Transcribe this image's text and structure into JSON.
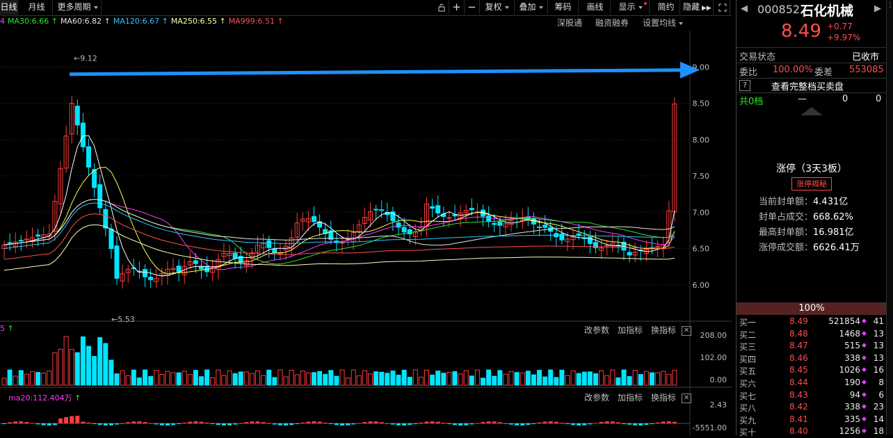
{
  "toolbar": {
    "tab_daily": "日线",
    "tab_monthly": "月线",
    "more_periods": "更多周期",
    "fq": "复权",
    "overlay": "叠加",
    "chips": "筹码",
    "draw": "画线",
    "display": "显示",
    "simple": "简约",
    "hide": "隐藏"
  },
  "ma_legend": [
    {
      "text": "4",
      "color": "#ff3cff"
    },
    {
      "text": "MA30:6.66",
      "color": "#2ee62e"
    },
    {
      "text": "MA60:6.82",
      "color": "#e6e6e6"
    },
    {
      "text": "MA120:6.67",
      "color": "#2fc8ff"
    },
    {
      "text": "MA250:6.55",
      "color": "#ffffb0"
    },
    {
      "text": "MA999:6.51",
      "color": "#ff5050"
    }
  ],
  "chart_links": {
    "sgt": "深股通",
    "margin": "融资融券",
    "ma_settings": "设置均线"
  },
  "chart_data": {
    "type": "candlestick",
    "y_axis_ticks": [
      "9.00",
      "8.50",
      "8.00",
      "7.50",
      "7.00",
      "6.50",
      "6.00"
    ],
    "ylim": [
      5.5,
      9.5
    ],
    "annotations": {
      "high": "9.12",
      "low": "5.53"
    },
    "last_close": 8.49,
    "volume_axis": [
      "208.00",
      "102.00",
      "0.00"
    ],
    "macd_axis": [
      "2.43",
      "-5551.00"
    ],
    "ma_series_names": [
      "MA30",
      "MA60",
      "MA120",
      "MA250",
      "MA999"
    ],
    "colors": {
      "up": "#ff3c3c",
      "down": "#00e5ff",
      "ma5": "#ffffff",
      "ma10": "#ffff55",
      "ma20": "#ff3cff",
      "ma30": "#2ee62e",
      "ma60": "#e6e6e6",
      "ma120": "#2fc8ff",
      "ma250": "#ffffb0",
      "ma999": "#ff5050",
      "arrow": "#1e90ff"
    }
  },
  "volume_panel": {
    "legend": "5",
    "edit": "改参数",
    "add": "加指标",
    "switch": "换指标"
  },
  "macd_panel": {
    "legend": "ma20:112.404万",
    "edit": "改参数",
    "add": "加指标",
    "switch": "换指标"
  },
  "quote": {
    "code": "000852",
    "name": "石化机械",
    "price": "8.49",
    "change": "+0.77",
    "change_pct": "+9.97%",
    "trade_status_label": "交易状态",
    "trade_status": "已收市",
    "weibi_label": "委比",
    "weibi": "100.00%",
    "weicha_label": "委差",
    "weicha": "553085",
    "full_book": "查看完整档买卖盘",
    "levels_label": "共0档",
    "levels_dash": "—",
    "levels_v1": "0",
    "levels_v2": "0",
    "limit_title": "涨停（3天3板）",
    "limit_tag": "涨停揭秘",
    "stat1_label": "当前封单额：",
    "stat1": "4.431亿",
    "stat2_label": "封单占成交：",
    "stat2": "668.62%",
    "stat3_label": "最高封单额：",
    "stat3": "16.981亿",
    "stat4_label": "涨停成交额：",
    "stat4": "6626.41万",
    "bid_pct": "100%",
    "bids": [
      {
        "label": "买一",
        "price": "8.49",
        "vol": "521854",
        "cnt": "41",
        "mark": true
      },
      {
        "label": "买二",
        "price": "8.48",
        "vol": "1468",
        "cnt": "13",
        "mark": true
      },
      {
        "label": "买三",
        "price": "8.47",
        "vol": "515",
        "cnt": "13",
        "mark": true
      },
      {
        "label": "买四",
        "price": "8.46",
        "vol": "338",
        "cnt": "13",
        "mark": true
      },
      {
        "label": "买五",
        "price": "8.45",
        "vol": "1026",
        "cnt": "16",
        "mark": true
      },
      {
        "label": "买六",
        "price": "8.44",
        "vol": "190",
        "cnt": "8",
        "mark": true
      },
      {
        "label": "买七",
        "price": "8.43",
        "vol": "94",
        "cnt": "6",
        "mark": true
      },
      {
        "label": "买八",
        "price": "8.42",
        "vol": "338",
        "cnt": "23",
        "mark": true
      },
      {
        "label": "买九",
        "price": "8.41",
        "vol": "335",
        "cnt": "14",
        "mark": true
      },
      {
        "label": "买十",
        "price": "8.40",
        "vol": "1256",
        "cnt": "18",
        "mark": true
      }
    ]
  }
}
